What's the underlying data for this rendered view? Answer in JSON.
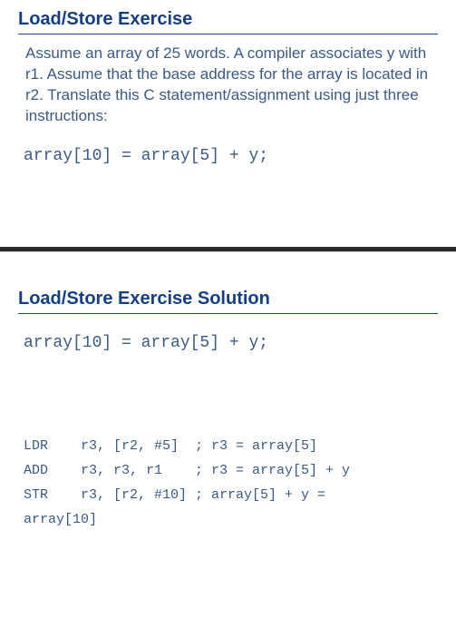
{
  "slide1": {
    "title": "Load/Store Exercise",
    "description": "Assume an array of 25 words.  A compiler associates y with r1.  Assume that the base address for the array is located in r2.  Translate this C statement/assignment using just three instructions:",
    "code": "array[10] = array[5] + y;"
  },
  "slide2": {
    "title": "Load/Store Exercise Solution",
    "code": "array[10] = array[5] + y;",
    "asm": {
      "line1": "LDR    r3, [r2, #5]  ; r3 = array[5]",
      "line2": "ADD    r3, r3, r1    ; r3 = array[5] + y",
      "line3": "STR    r3, [r2, #10] ; array[5] + y =",
      "line4": "array[10]"
    }
  }
}
